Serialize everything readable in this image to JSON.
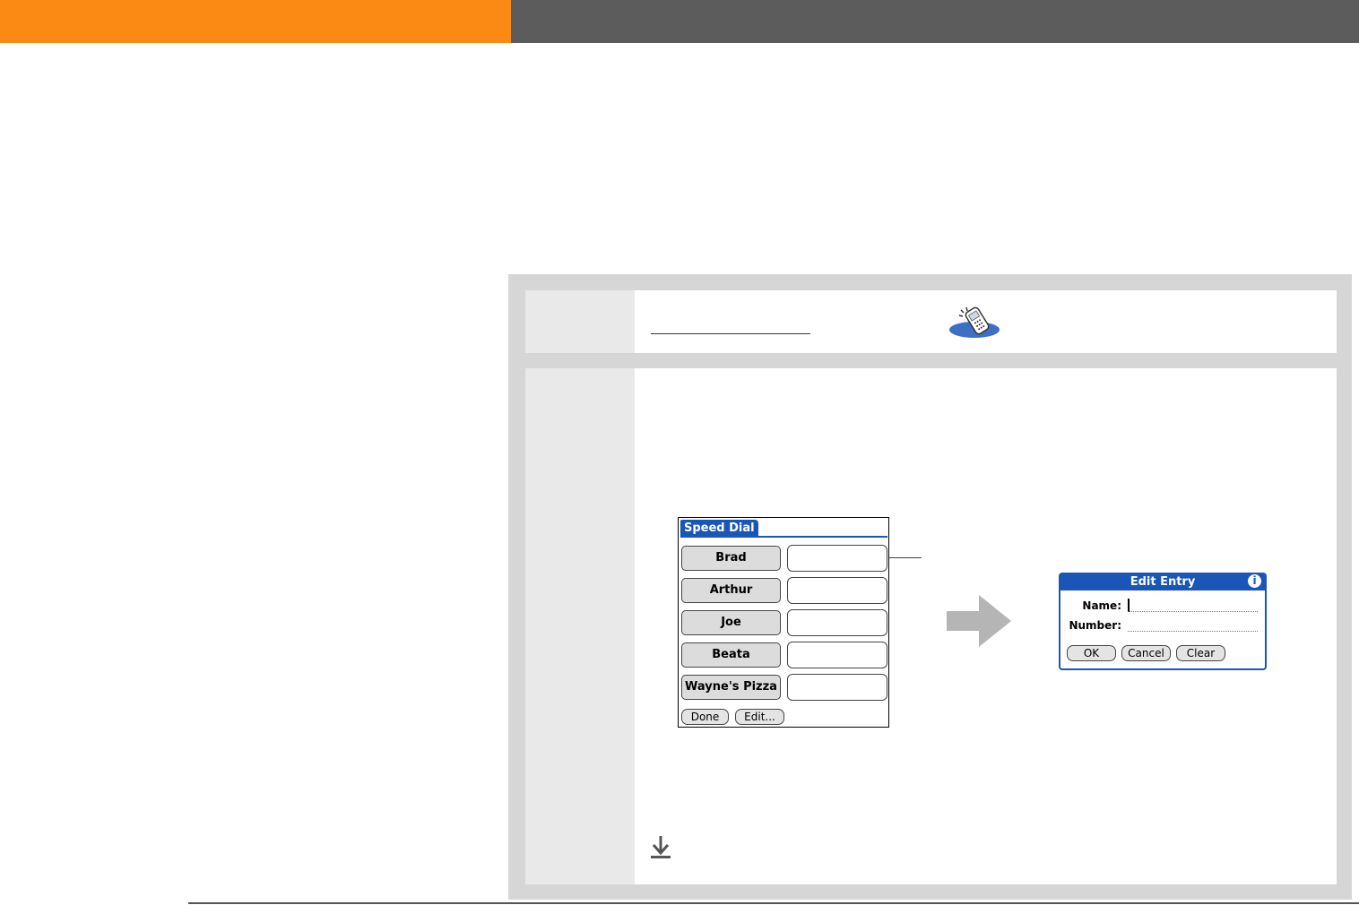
{
  "colors": {
    "header_orange": "#fb8a14",
    "header_gray": "#5c5c5c",
    "palm_blue": "#1a56b8",
    "arrow_gray": "#b5b5b5"
  },
  "phone_app_icon": "phone-app-icon",
  "speed_dial": {
    "title": "Speed Dial",
    "entries": [
      "Brad",
      "Arthur",
      "Joe",
      "Beata",
      "Wayne's Pizza"
    ],
    "done_label": "Done",
    "edit_label": "Edit..."
  },
  "edit_entry": {
    "title": "Edit Entry",
    "info_icon": "i",
    "name_label": "Name:",
    "number_label": "Number:",
    "ok_label": "OK",
    "cancel_label": "Cancel",
    "clear_label": "Clear"
  }
}
